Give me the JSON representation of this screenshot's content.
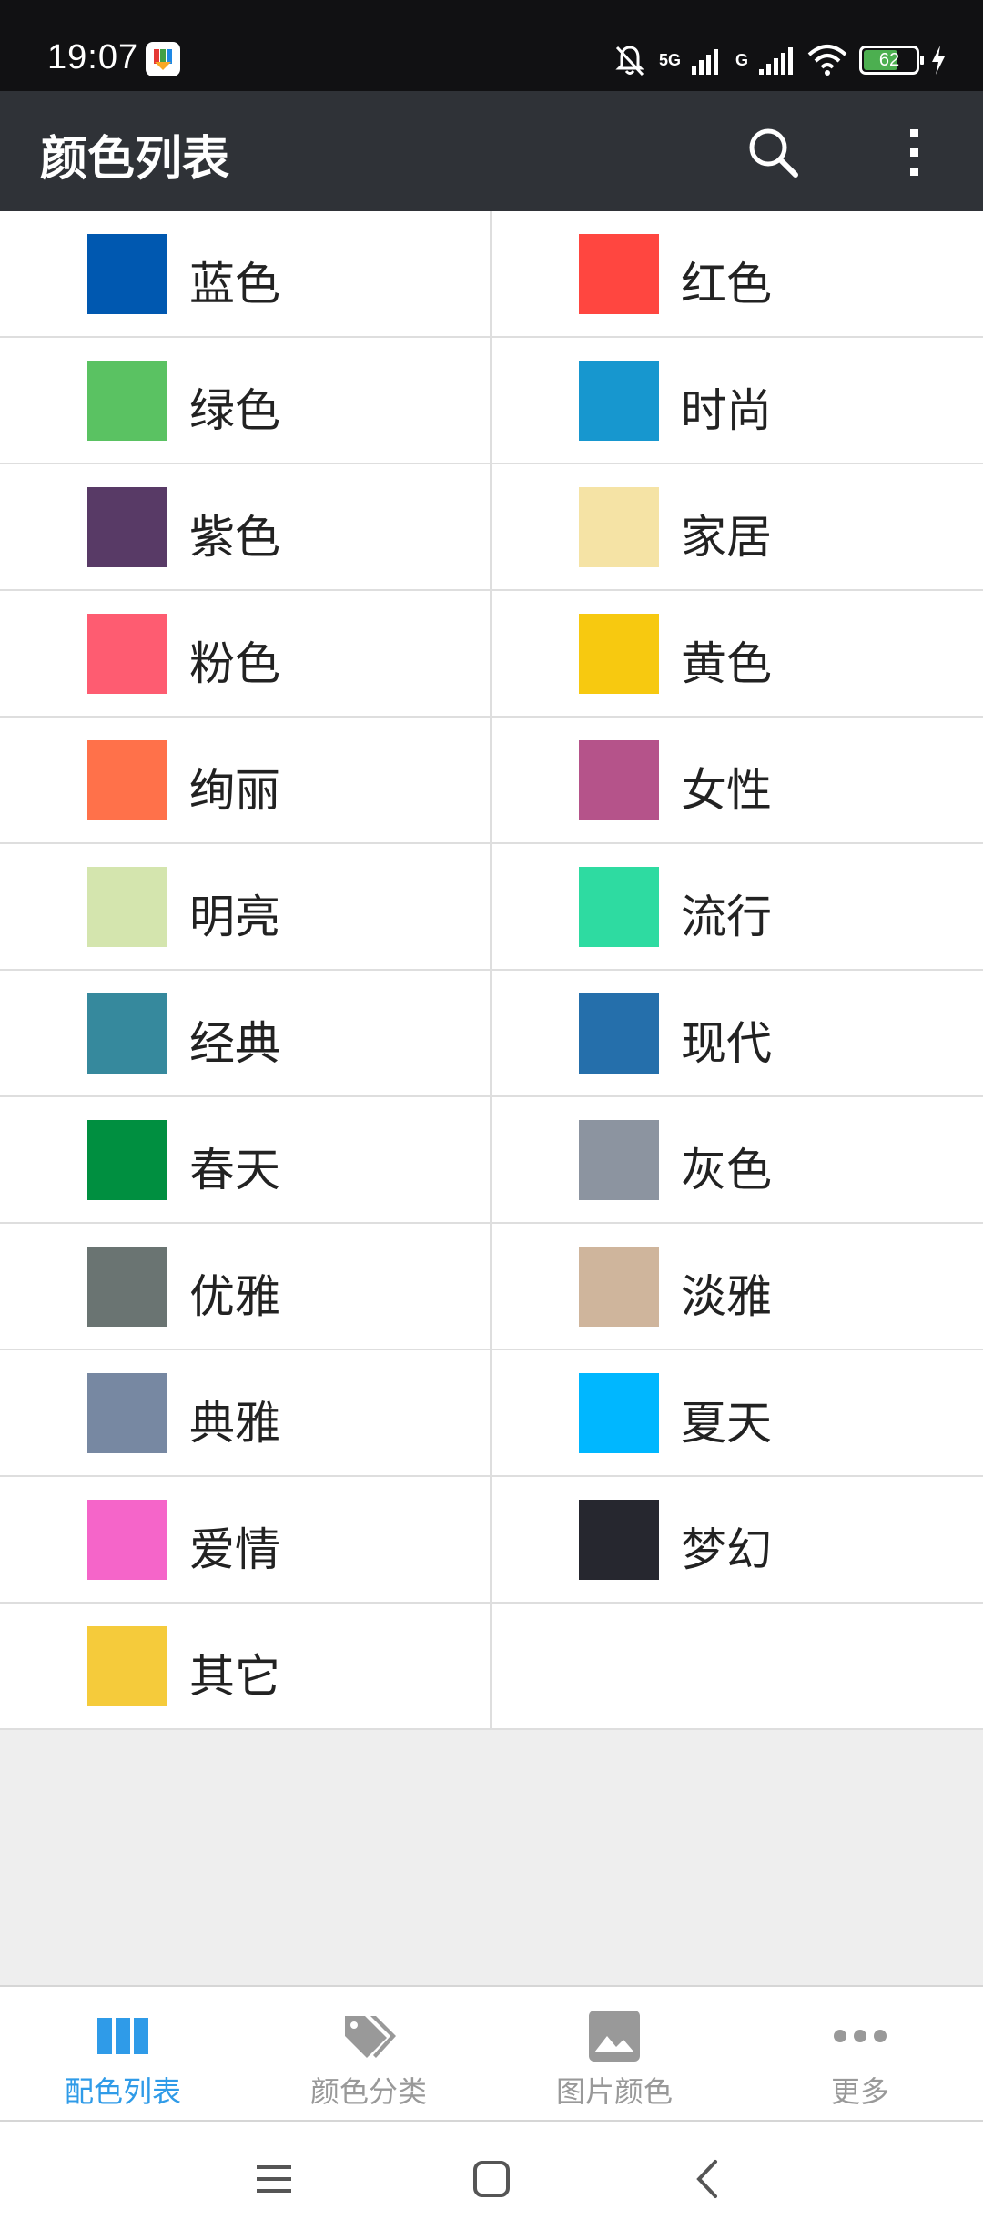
{
  "status_bar": {
    "time": "19:07",
    "network_1": "5G",
    "network_2": "G",
    "battery": "62"
  },
  "toolbar": {
    "title": "颜色列表",
    "search_icon": "search-icon",
    "more_icon": "more-vert-icon"
  },
  "colors": [
    {
      "label": "蓝色",
      "color": "#0058b0"
    },
    {
      "label": "红色",
      "color": "#ff4640"
    },
    {
      "label": "绿色",
      "color": "#5ac262"
    },
    {
      "label": "时尚",
      "color": "#1797cf"
    },
    {
      "label": "紫色",
      "color": "#583a66"
    },
    {
      "label": "家居",
      "color": "#f5e3a5"
    },
    {
      "label": "粉色",
      "color": "#fe5c71"
    },
    {
      "label": "黄色",
      "color": "#f7c910"
    },
    {
      "label": "绚丽",
      "color": "#ff714a"
    },
    {
      "label": "女性",
      "color": "#b5538a"
    },
    {
      "label": "明亮",
      "color": "#d4e5ae"
    },
    {
      "label": "流行",
      "color": "#2edba1"
    },
    {
      "label": "经典",
      "color": "#36899d"
    },
    {
      "label": "现代",
      "color": "#256fab"
    },
    {
      "label": "春天",
      "color": "#008f40"
    },
    {
      "label": "灰色",
      "color": "#8c94a0"
    },
    {
      "label": "优雅",
      "color": "#6a7472"
    },
    {
      "label": "淡雅",
      "color": "#cfb59c"
    },
    {
      "label": "典雅",
      "color": "#7788a2"
    },
    {
      "label": "夏天",
      "color": "#00b7ff"
    },
    {
      "label": "爱情",
      "color": "#f565c9"
    },
    {
      "label": "梦幻",
      "color": "#26272f"
    },
    {
      "label": "其它",
      "color": "#f5cb3b"
    }
  ],
  "bottom_nav": {
    "items": [
      {
        "label": "配色列表",
        "icon": "columns-icon",
        "active": true
      },
      {
        "label": "颜色分类",
        "icon": "tags-icon",
        "active": false
      },
      {
        "label": "图片颜色",
        "icon": "image-icon",
        "active": false
      },
      {
        "label": "更多",
        "icon": "more-horiz-icon",
        "active": false
      }
    ],
    "active_color": "#2f9be8",
    "inactive_color": "#999999"
  },
  "system_nav": {
    "menu_icon": "menu-icon",
    "home_icon": "home-icon",
    "back_icon": "back-icon"
  }
}
